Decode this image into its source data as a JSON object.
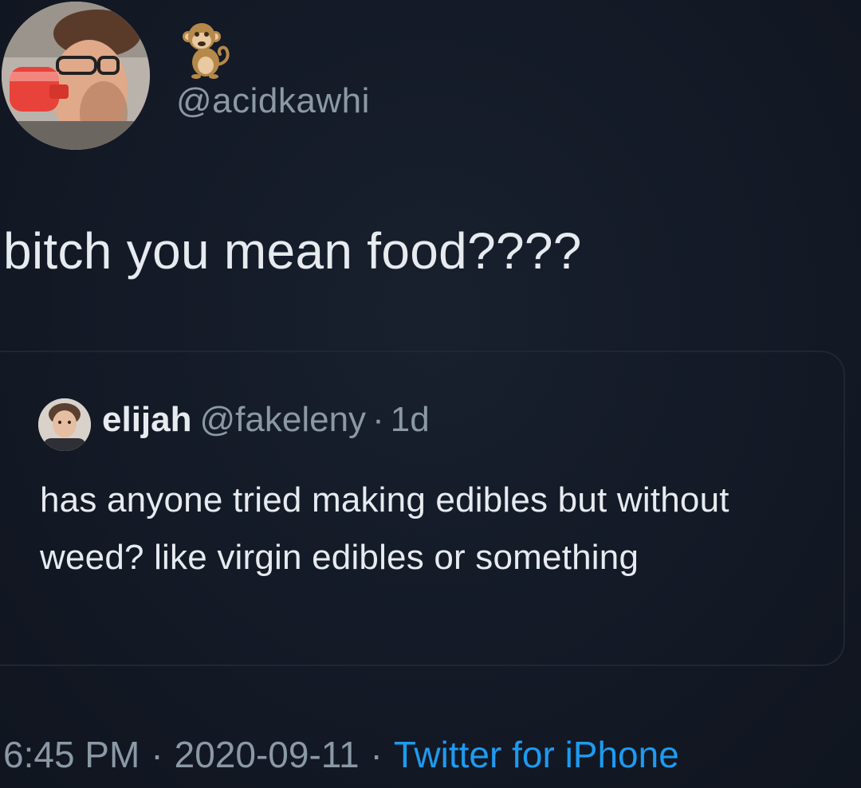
{
  "tweet": {
    "display_name_icon": "monkey-emoji",
    "handle": "@acidkawhi",
    "text": "bitch you mean food????"
  },
  "quoted_tweet": {
    "name": "elijah",
    "handle": "@fakeleny",
    "separator": "·",
    "time": "1d",
    "text": "has anyone tried making edibles but without weed? like virgin edibles or something"
  },
  "footer": {
    "time": "6:45 PM",
    "separator": "·",
    "date": "2020-09-11",
    "source": "Twitter for iPhone"
  },
  "colors": {
    "background": "#141a26",
    "text": "#e7ebf0",
    "muted": "#8b98a5",
    "link": "#1d9bf0"
  }
}
